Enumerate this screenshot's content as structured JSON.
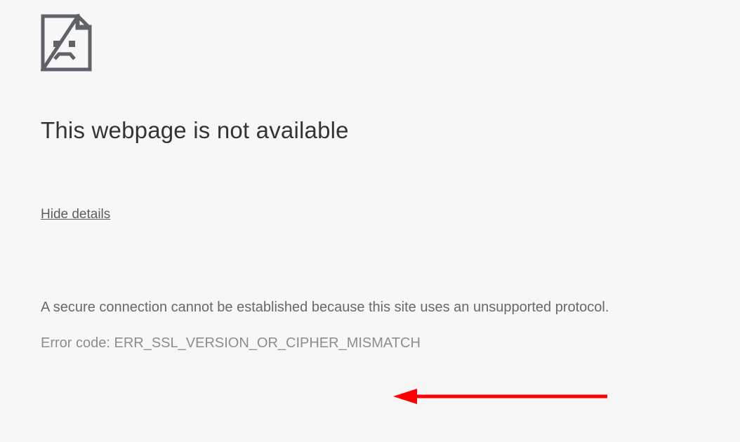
{
  "icon": "sad-page-icon",
  "title": "This webpage is not available",
  "toggle": "Hide details",
  "detail": "A secure connection cannot be established because this site uses an unsupported protocol.",
  "errorLabel": "Error code: ",
  "errorCode": "ERR_SSL_VERSION_OR_CIPHER_MISMATCH"
}
